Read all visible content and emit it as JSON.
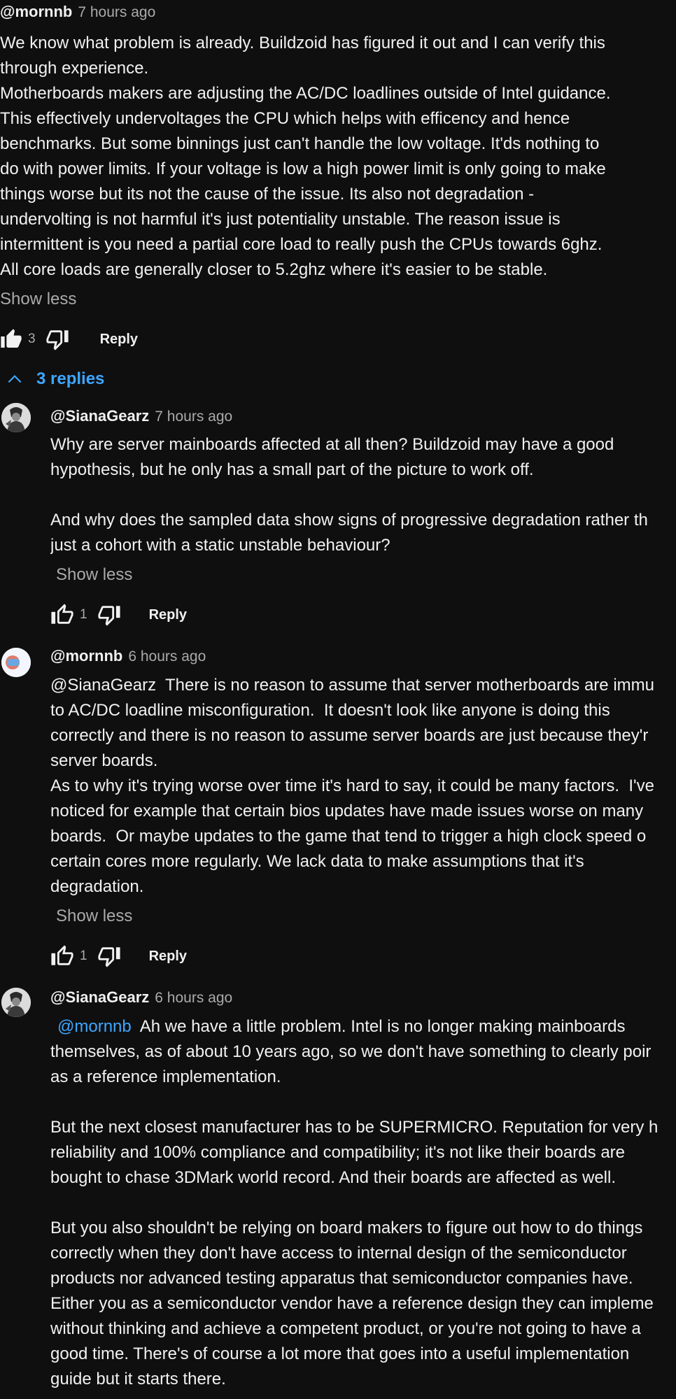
{
  "top_comment": {
    "author": "@mornnb",
    "time": "7 hours ago",
    "text": "We know what problem is already. Buildzoid has figured it out and I can verify this\nthrough experience.\nMotherboards makers are adjusting the AC/DC loadlines outside of Intel guidance.\nThis effectively undervoltages the CPU which helps with efficency and hence\nbenchmarks.  But some binnings just can't handle the low voltage.  It'ds nothing to\ndo with power limits.  If your voltage is low a high power limit is only going to make\nthings worse but its not the cause of the issue.  Its also not degradation -\nundervolting is not harmful it's just potentiality unstable.  The reason issue is\nintermittent is you need a partial core load to really push the CPUs towards 6ghz.\nAll core loads are generally closer to 5.2ghz where it's easier to be stable.",
    "show_less": "Show less",
    "likes": "3",
    "reply": "Reply"
  },
  "replies_toggle": "3 replies",
  "replies": [
    {
      "author": "@SianaGearz",
      "time": "7 hours ago",
      "text": "Why are server mainboards affected at all then? Buildzoid may have a good\nhypothesis, but he only has a small part of the picture to work off.\n\nAnd why does the sampled data show signs of progressive degradation rather th\njust a cohort with a static unstable behaviour?",
      "show_less": "Show less",
      "likes": "1",
      "reply": "Reply"
    },
    {
      "author": "@mornnb",
      "time": "6 hours ago",
      "text": "@SianaGearz  There is no reason to assume that server motherboards are immu\nto AC/DC loadline misconfiguration.  It doesn't look like anyone is doing this\ncorrectly and there is no reason to assume server boards are just because they'r\nserver boards.\nAs to why it's trying worse over time it's hard to say, it could be many factors.  I've\nnoticed for example that certain bios updates have made issues worse on many\nboards.  Or maybe updates to the game that tend to trigger a high clock speed o\ncertain cores more regularly. We lack data to make assumptions that it's\ndegradation.",
      "show_less": "Show less",
      "likes": "1",
      "reply": "Reply"
    },
    {
      "author": "@SianaGearz",
      "time": "6 hours ago",
      "mention": "@mornnb",
      "text": "  Ah we have a little problem. Intel is no longer making mainboards\nthemselves, as of about 10 years ago, so we don't have something to clearly poir\nas a reference implementation.\n\nBut the next closest manufacturer has to be SUPERMICRO. Reputation for very h\nreliability and 100% compliance and compatibility; it's not like their boards are\nbought to chase 3DMark world record. And their boards are affected as well.\n\nBut you also shouldn't be relying on board makers to figure out how to do things\ncorrectly when they don't have access to internal design of the semiconductor\nproducts nor advanced testing apparatus that semiconductor companies have.\nEither you as a semiconductor vendor have a reference design they can impleme\nwithout thinking and achieve a competent product, or you're not going to have a\ngood time. There's of course a lot more that goes into a useful implementation\nguide but it starts there."
    }
  ]
}
